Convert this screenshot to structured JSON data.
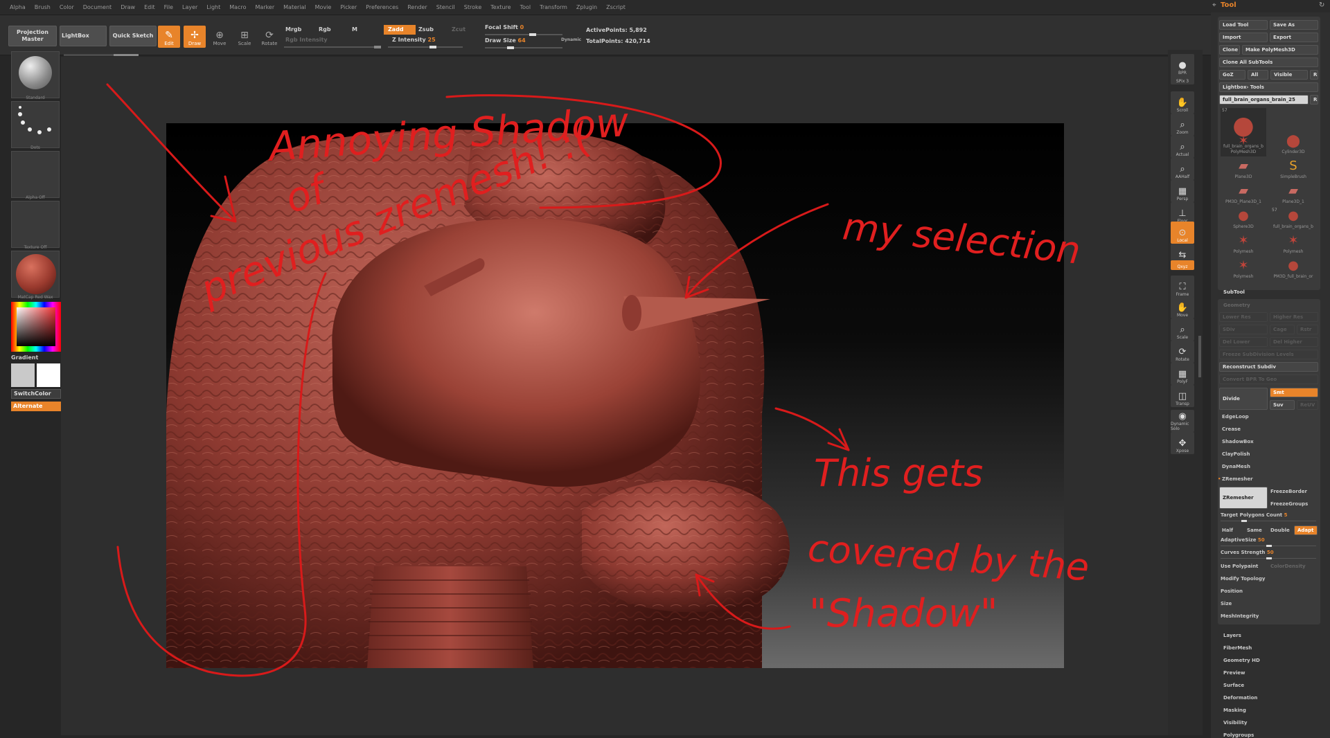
{
  "menu": [
    "Alpha",
    "Brush",
    "Color",
    "Document",
    "Draw",
    "Edit",
    "File",
    "Layer",
    "Light",
    "Macro",
    "Marker",
    "Material",
    "Movie",
    "Picker",
    "Preferences",
    "Render",
    "Stencil",
    "Stroke",
    "Texture",
    "Tool",
    "Transform",
    "Zplugin",
    "Zscript"
  ],
  "toolbar": {
    "projection_master": "Projection Master",
    "lightbox": "LightBox",
    "quick_sketch": "Quick Sketch",
    "edit": "Edit",
    "draw": "Draw",
    "move": "Move",
    "scale": "Scale",
    "rotate": "Rotate",
    "mrgb": "Mrgb",
    "rgb": "Rgb",
    "m": "M",
    "rgb_intensity": "Rgb Intensity",
    "zadd": "Zadd",
    "zsub": "Zsub",
    "zcut": "Zcut",
    "z_intensity_label": "Z Intensity",
    "z_intensity_value": "25",
    "focal_shift_label": "Focal Shift",
    "focal_shift_value": "0",
    "draw_size_label": "Draw Size",
    "draw_size_value": "64",
    "dynamic": "Dynamic",
    "active_points": "ActivePoints: 5,892",
    "total_points": "TotalPoints: 420,714"
  },
  "left_shelf": {
    "brush": "Standard",
    "stroke": "Dots",
    "alpha": "Alpha Off",
    "texture": "Texture Off",
    "material": "MatCap Red Wax",
    "gradient": "Gradient",
    "switch_color": "SwitchColor",
    "alternate": "Alternate"
  },
  "right_shelf": [
    {
      "name": "bpr-button",
      "label": "BPR",
      "icon": "sphere-icon"
    },
    {
      "name": "spix-button",
      "label": "SPix 3",
      "icon": ""
    },
    {
      "name": "scroll-button",
      "label": "Scroll",
      "icon": "hand-icon"
    },
    {
      "name": "zoom-button",
      "label": "Zoom",
      "icon": "magnifier-icon"
    },
    {
      "name": "actual-button",
      "label": "Actual",
      "icon": "magnifier-icon"
    },
    {
      "name": "aahalf-button",
      "label": "AAHalf",
      "icon": "magnifier-icon"
    },
    {
      "name": "persp-button",
      "label": "Persp",
      "icon": "grid-icon"
    },
    {
      "name": "floor-button",
      "label": "Floor",
      "icon": "floor-icon"
    },
    {
      "name": "local-button",
      "label": "Local",
      "icon": "local-icon"
    },
    {
      "name": "lsym-button",
      "label": "L.Sym",
      "icon": "sym-icon"
    },
    {
      "name": "xyz-button",
      "label": "Qxyz",
      "icon": ""
    },
    {
      "name": "frame-button",
      "label": "Frame",
      "icon": "frame-icon"
    },
    {
      "name": "move-button",
      "label": "Move",
      "icon": "hand-icon"
    },
    {
      "name": "scale-button",
      "label": "Scale",
      "icon": "magnifier-icon"
    },
    {
      "name": "rotate-button",
      "label": "Rotate",
      "icon": "rotate-icon"
    },
    {
      "name": "polyf-button",
      "label": "PolyF",
      "icon": "grid-icon"
    },
    {
      "name": "transp-button",
      "label": "Transp",
      "icon": "transp-icon"
    },
    {
      "name": "solo-button",
      "label": "Dynamic Solo",
      "icon": "solo-icon"
    },
    {
      "name": "xpose-button",
      "label": "Xpose",
      "icon": "xpose-icon"
    }
  ],
  "tool": {
    "title": "Tool",
    "load_tool": "Load Tool",
    "save_as": "Save As",
    "import": "Import",
    "export": "Export",
    "clone": "Clone",
    "make_polymesh": "Make PolyMesh3D",
    "clone_all": "Clone All SubTools",
    "goz": "GoZ",
    "all": "All",
    "visible": "Visible",
    "r": "R",
    "lightbox_tools": "Lightbox› Tools",
    "current_tool": "full_brain_organs_brain_25",
    "tools": [
      {
        "label": "full_brain_organs_b",
        "badge": "57"
      },
      {
        "label": "Cylinder3D",
        "badge": ""
      },
      {
        "label": "PolyMesh3D",
        "badge": ""
      },
      {
        "label": "SimpleBrush",
        "badge": ""
      },
      {
        "label": "Plane3D",
        "badge": ""
      },
      {
        "label": "Plane3D_1",
        "badge": ""
      },
      {
        "label": "PM3D_Plane3D_1",
        "badge": ""
      },
      {
        "label": "full_brain_organs_b",
        "badge": "57"
      },
      {
        "label": "Sphere3D",
        "badge": ""
      },
      {
        "label": "Polymesh",
        "badge": ""
      },
      {
        "label": "Polymesh",
        "badge": ""
      },
      {
        "label": "PM3D_full_brain_or",
        "badge": ""
      },
      {
        "label": "Polymesh",
        "badge": ""
      }
    ],
    "subtool": "SubTool",
    "geometry": "Geometry",
    "lower_res": "Lower Res",
    "higher_res": "Higher Res",
    "sdiv": "SDiv",
    "cage": "Cage",
    "rstr": "Rstr",
    "del_lower": "Del Lower",
    "del_higher": "Del Higher",
    "freeze_subdiv": "Freeze SubDivision Levels",
    "reconstruct_subdiv": "Reconstruct Subdiv",
    "convert_bpr": "Convert BPR To Geo",
    "divide": "Divide",
    "smt": "Smt",
    "suv": "Suv",
    "reuv": "ReUV",
    "edgeloop": "EdgeLoop",
    "crease": "Crease",
    "shadowbox": "ShadowBox",
    "claypolish": "ClayPolish",
    "dynamesh": "DynaMesh",
    "zremesher_section": "ZRemesher",
    "zremesher_btn": "ZRemesher",
    "freezeborder": "FreezeBorder",
    "freezegroups": "FreezeGroups",
    "target_polys_label": "Target Polygons Count",
    "target_polys_value": "5",
    "half": "Half",
    "same": "Same",
    "double": "Double",
    "adapt": "Adapt",
    "adaptive_label": "AdaptiveSize",
    "adaptive_value": "50",
    "curves_label": "Curves Strength",
    "curves_value": "50",
    "use_polypaint": "Use Polypaint",
    "color_density": "ColorDensity",
    "modify_topology": "Modify Topology",
    "position": "Position",
    "size": "Size",
    "meshintegrity": "MeshIntegrity",
    "sections": [
      "Layers",
      "FiberMesh",
      "Geometry HD",
      "Preview",
      "Surface",
      "Deformation",
      "Masking",
      "Visibility",
      "Polygroups"
    ]
  },
  "annotations": {
    "a1": "Annoying Shadow",
    "a2": "of",
    "a3": "previous zremesh! :(",
    "a4": "my selection",
    "a5": "This gets",
    "a6": "covered by the",
    "a7": "\"Shadow\""
  },
  "colors": {
    "accent": "#e8842a",
    "annotation": "#d81a1a",
    "mesh": "#a4453d"
  }
}
